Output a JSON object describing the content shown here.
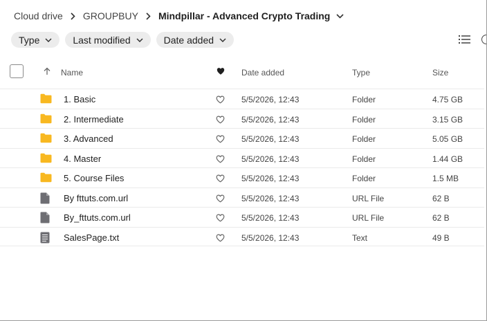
{
  "breadcrumb": {
    "items": [
      "Cloud drive",
      "GROUPBUY"
    ],
    "current": "Mindpillar - Advanced Crypto Trading"
  },
  "filters": [
    {
      "label": "Type"
    },
    {
      "label": "Last modified"
    },
    {
      "label": "Date added"
    }
  ],
  "table": {
    "headers": {
      "name": "Name",
      "date": "Date added",
      "type": "Type",
      "size": "Size"
    },
    "rows": [
      {
        "name": "1. Basic",
        "date": "5/5/2026, 12:43",
        "type": "Folder",
        "size": "4.75 GB",
        "icon": "folder-icon"
      },
      {
        "name": "2. Intermediate",
        "date": "5/5/2026, 12:43",
        "type": "Folder",
        "size": "3.15 GB",
        "icon": "folder-icon"
      },
      {
        "name": "3. Advanced",
        "date": "5/5/2026, 12:43",
        "type": "Folder",
        "size": "5.05 GB",
        "icon": "folder-icon"
      },
      {
        "name": "4. Master",
        "date": "5/5/2026, 12:43",
        "type": "Folder",
        "size": "1.44 GB",
        "icon": "folder-icon"
      },
      {
        "name": "5. Course Files",
        "date": "5/5/2026, 12:43",
        "type": "Folder",
        "size": "1.5 MB",
        "icon": "folder-icon"
      },
      {
        "name": "By fttuts.com.url",
        "date": "5/5/2026, 12:43",
        "type": "URL File",
        "size": "62 B",
        "icon": "url-file-icon"
      },
      {
        "name": "By_fttuts.com.url",
        "date": "5/5/2026, 12:43",
        "type": "URL File",
        "size": "62 B",
        "icon": "url-file-icon"
      },
      {
        "name": "SalesPage.txt",
        "date": "5/5/2026, 12:43",
        "type": "Text",
        "size": "49 B",
        "icon": "text-file-icon"
      }
    ]
  },
  "colors": {
    "folder": "#f8b820",
    "file": "#6e6e73",
    "chip": "#ececec"
  }
}
